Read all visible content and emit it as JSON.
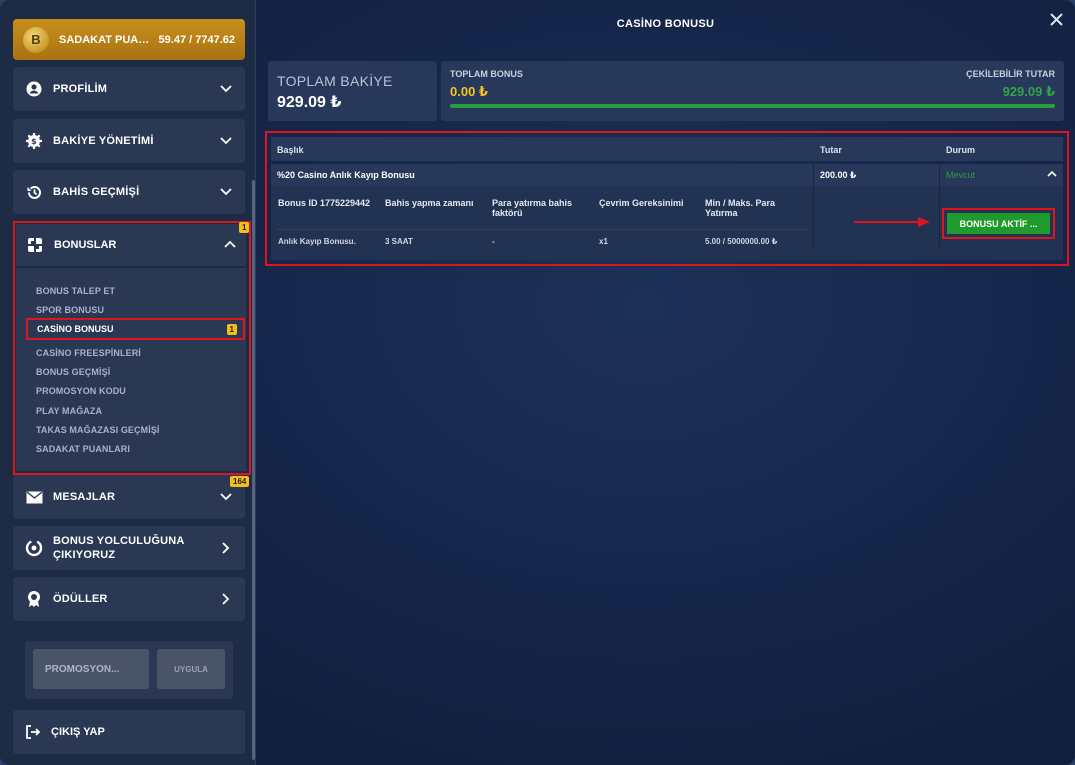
{
  "modal_title": "CASİNO BONUSU",
  "loyalty": {
    "coin_letter": "B",
    "label": "SADAKAT PUANLARI",
    "value": "59.47 / 7747.62"
  },
  "menu": {
    "profile": "PROFİLİM",
    "balance": "BAKİYE YÖNETİMİ",
    "bet_history": "BAHİS GEÇMİŞİ",
    "bonuses": "BONUSLAR",
    "bonuses_badge": "1",
    "messages": "MESAJLAR",
    "messages_badge": "164",
    "journey_line1": "BONUS YOLCULUĞUNA",
    "journey_line2": "ÇIKIYORUZ",
    "rewards": "ÖDÜLLER",
    "logout": "ÇIKIŞ YAP"
  },
  "submenu": [
    "BONUS TALEP ET",
    "SPOR BONUSU",
    "CASİNO BONUSU",
    "CASİNO FREESPİNLERİ",
    "BONUS GEÇMİŞİ",
    "PROMOSYON KODU",
    "PLAY MAĞAZA",
    "TAKAS MAĞAZASI GEÇMİŞİ",
    "SADAKAT PUANLARI"
  ],
  "submenu_active_badge": "1",
  "promo": {
    "placeholder": "PROMOSYON...",
    "button": "UYGULA"
  },
  "summary": {
    "total_label": "TOPLAM BAKİYE",
    "total_value": "929.09 ₺",
    "bonus_label": "TOPLAM BONUS",
    "bonus_value": "0.00 ₺",
    "withdrawable_label": "ÇEKİLEBİLİR TUTAR",
    "withdrawable_value": "929.09 ₺",
    "progress_fraction": 1.0
  },
  "table": {
    "headers": {
      "title": "Başlık",
      "amount": "Tutar",
      "status": "Durum"
    },
    "row": {
      "title": "%20 Casino Anlık Kayıp Bonusu",
      "amount": "200.00 ₺",
      "status": "Mevcut"
    },
    "detail_headers": [
      "Bonus ID 1775229442",
      "Bahis yapma zamanı",
      "Para yatırma bahis faktörü",
      "Çevrim Gereksinimi",
      "Min / Maks. Para Yatırma"
    ],
    "detail_values": [
      "Anlık Kayıp Bonusu.",
      "3 SAAT",
      "-",
      "x1",
      "5.00 / 5000000.00 ₺"
    ],
    "activate_button": "BONUSU AKTİF ..."
  },
  "colors": {
    "accent_red": "#e0151b",
    "green": "#1f9a2c",
    "gold": "#f6c41b"
  }
}
